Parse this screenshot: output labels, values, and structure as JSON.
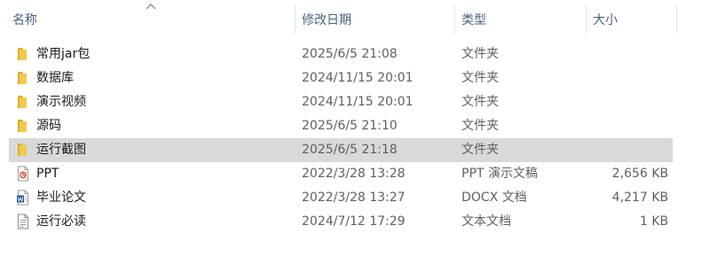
{
  "columns": {
    "name": "名称",
    "date": "修改日期",
    "type": "类型",
    "size": "大小"
  },
  "sort": {
    "column": "name",
    "direction": "ascending",
    "icon": "sort-up-chevron-icon"
  },
  "colors": {
    "folder": "#f2c94c",
    "folder_dark": "#e0ad2e",
    "ppt": "#d24726",
    "docx": "#2b579a",
    "selected_row": "#d9d9d9",
    "header_text": "#4c607a"
  },
  "files": [
    {
      "name": "常用jar包",
      "date": "2025/6/5 21:08",
      "type": "文件夹",
      "size": "",
      "icon": "folder-icon",
      "selected": false
    },
    {
      "name": "数据库",
      "date": "2024/11/15 20:01",
      "type": "文件夹",
      "size": "",
      "icon": "folder-icon",
      "selected": false
    },
    {
      "name": "演示视频",
      "date": "2024/11/15 20:01",
      "type": "文件夹",
      "size": "",
      "icon": "folder-icon",
      "selected": false
    },
    {
      "name": "源码",
      "date": "2025/6/5 21:10",
      "type": "文件夹",
      "size": "",
      "icon": "folder-icon",
      "selected": false
    },
    {
      "name": "运行截图",
      "date": "2025/6/5 21:18",
      "type": "文件夹",
      "size": "",
      "icon": "folder-icon",
      "selected": true
    },
    {
      "name": "PPT",
      "date": "2022/3/28 13:28",
      "type": "PPT 演示文稿",
      "size": "2,656 KB",
      "icon": "pptx-file-icon",
      "selected": false
    },
    {
      "name": "毕业论文",
      "date": "2022/3/28 13:27",
      "type": "DOCX 文档",
      "size": "4,217 KB",
      "icon": "docx-file-icon",
      "selected": false
    },
    {
      "name": "运行必读",
      "date": "2024/7/12 17:29",
      "type": "文本文档",
      "size": "1 KB",
      "icon": "txt-file-icon",
      "selected": false
    }
  ]
}
